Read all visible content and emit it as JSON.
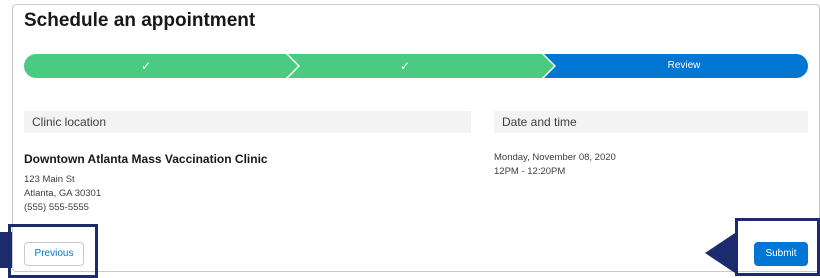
{
  "page": {
    "title": "Schedule an appointment"
  },
  "progress": {
    "steps": [
      {
        "label": "",
        "state": "complete",
        "icon": "check-icon"
      },
      {
        "label": "",
        "state": "complete",
        "icon": "check-icon"
      },
      {
        "label": "Review",
        "state": "current"
      }
    ],
    "colors": {
      "complete": "#4bca81",
      "current": "#0176d3"
    }
  },
  "clinic": {
    "header": "Clinic location",
    "name": "Downtown Atlanta Mass Vaccination Clinic",
    "address_line1": "123 Main St",
    "address_line2": "Atlanta, GA 30301",
    "phone": "(555) 555-5555"
  },
  "datetime": {
    "header": "Date and time",
    "date": "Monday, November 08, 2020",
    "time": "12PM - 12:20PM"
  },
  "actions": {
    "previous_label": "Previous",
    "submit_label": "Submit"
  },
  "annotations": {
    "highlight_color": "#1c2b6e"
  }
}
